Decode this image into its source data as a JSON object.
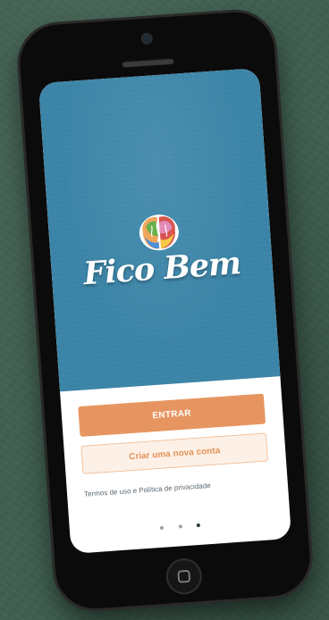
{
  "app": {
    "name": "Fico Bem"
  },
  "actions": {
    "login_label": "ENTRAR",
    "signup_label": "Criar uma nova conta"
  },
  "legal": {
    "terms_text": "Termos de uso e Política de privacidade"
  },
  "pager": {
    "total": 3,
    "active_index": 2
  },
  "colors": {
    "splash_background": "#3b85a8",
    "primary_button": "#e79560",
    "secondary_button_text": "#e49259",
    "secondary_button_background": "#fdf1e7"
  },
  "icons": {
    "logo": "brain-logo-icon",
    "home": "home-button-icon"
  }
}
